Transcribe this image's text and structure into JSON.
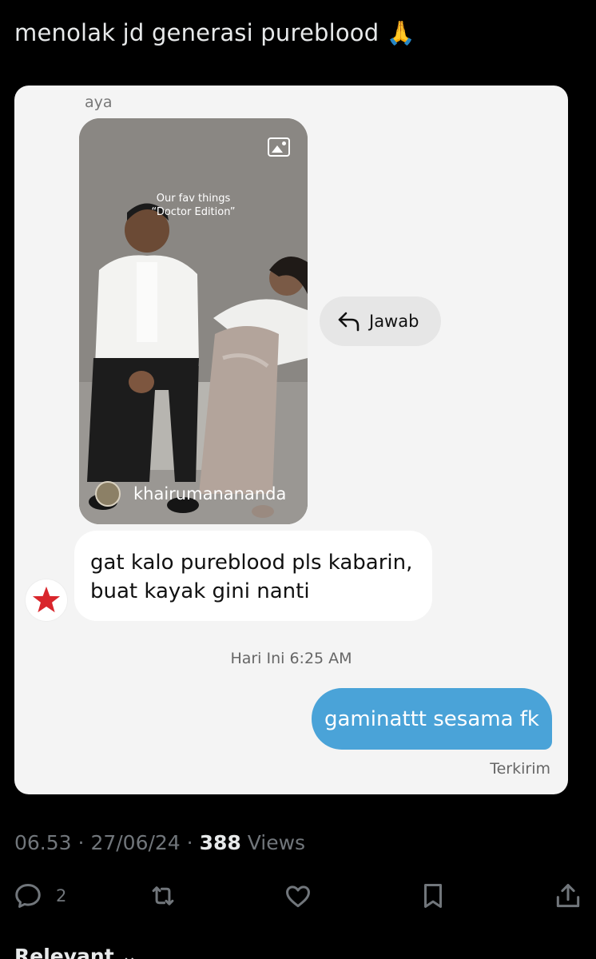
{
  "tweet": {
    "text": "menolak jd generasi pureblood 🙏"
  },
  "chat": {
    "sender_name": "aya",
    "story": {
      "caption_line1": "Our fav things",
      "caption_line2": "“Doctor Edition”",
      "username": "khairumananandа"
    },
    "reply_chip_label": "Jawab",
    "incoming_message_line1": "gat kalo pureblood pls kabarin,",
    "incoming_message_line2": "buat kayak gini nanti",
    "timestamp": "Hari Ini 6:25 AM",
    "outgoing_message": "gaminattt sesama fk",
    "sent_status": "Terkirim",
    "colors": {
      "card_bg": "#f4f4f4",
      "outgoing_bubble": "#4aa3d8",
      "star": "#d9262c"
    }
  },
  "meta": {
    "time": "06.53",
    "date": "27/06/24",
    "views_count": "388",
    "views_label": "Views"
  },
  "actions": {
    "reply_count": "2",
    "icons": [
      "reply-icon",
      "retweet-icon",
      "like-icon",
      "bookmark-icon",
      "share-icon"
    ]
  },
  "sort_label": "Relevant ⌄"
}
